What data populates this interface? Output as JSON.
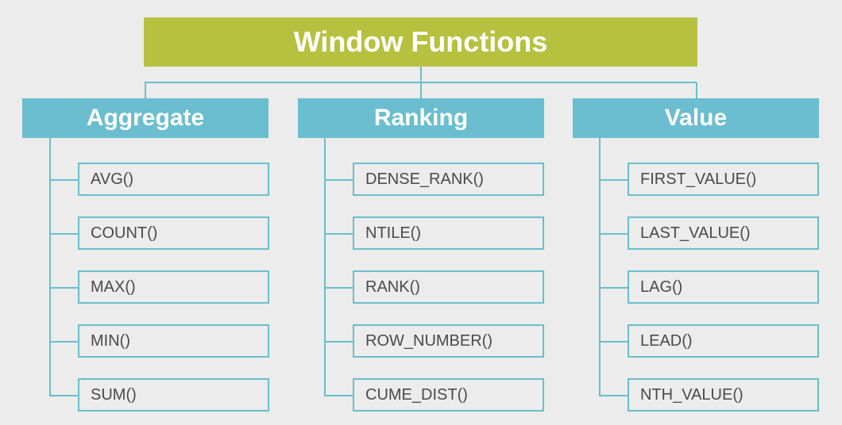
{
  "title": "Window Functions",
  "categories": [
    {
      "name": "Aggregate",
      "items": [
        "AVG()",
        "COUNT()",
        "MAX()",
        "MIN()",
        "SUM()"
      ]
    },
    {
      "name": "Ranking",
      "items": [
        "DENSE_RANK()",
        "NTILE()",
        "RANK()",
        "ROW_NUMBER()",
        "CUME_DIST()"
      ]
    },
    {
      "name": "Value",
      "items": [
        "FIRST_VALUE()",
        "LAST_VALUE()",
        "LAG()",
        "LEAD()",
        "NTH_VALUE()"
      ]
    }
  ],
  "colors": {
    "root": "#b7c140",
    "category": "#6abecf",
    "background": "#ebeceb",
    "item_text": "#4a4a4a"
  }
}
